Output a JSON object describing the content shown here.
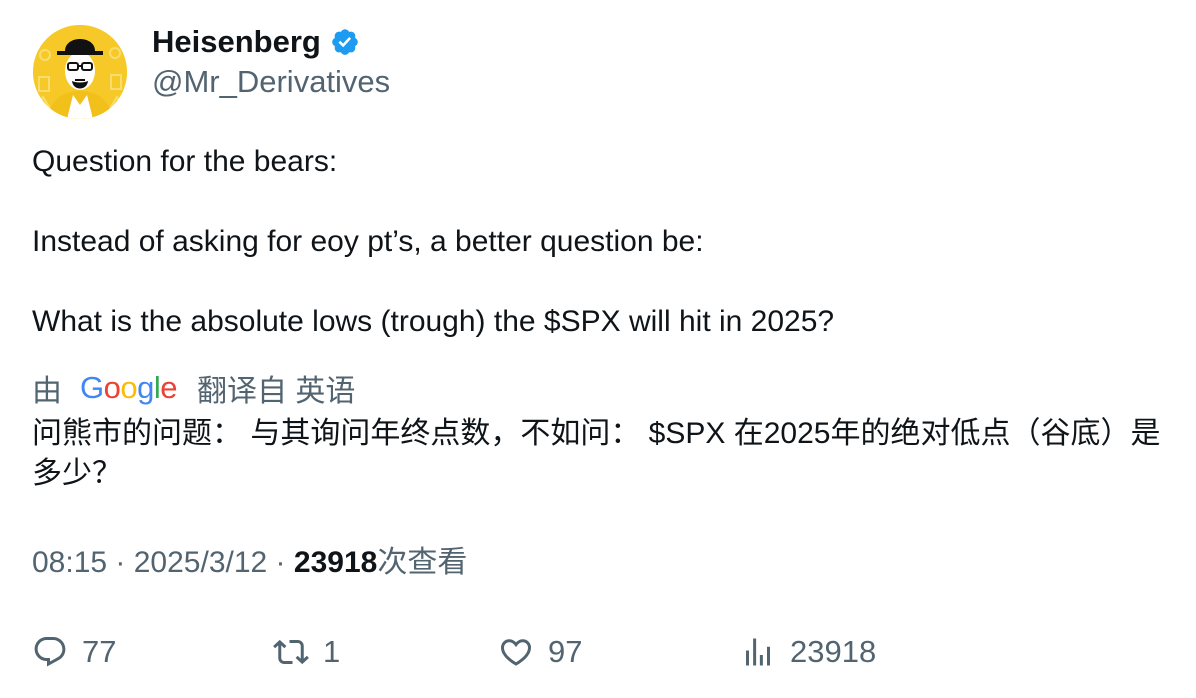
{
  "author": {
    "display_name": "Heisenberg",
    "handle": "@Mr_Derivatives",
    "verified": true,
    "verified_color": "#1d9bf0"
  },
  "tweet": {
    "lines": [
      "Question for the bears:",
      "Instead of asking for eoy pt’s, a better question be:",
      "What is the absolute lows (trough) the $SPX will hit in 2025?"
    ]
  },
  "translation": {
    "prefix": "由",
    "provider": "Google",
    "suffix": "翻译自 英语",
    "text": "问熊市的问题： 与其询问年终点数，不如问： $SPX 在2025年的绝对低点（谷底）是多少？"
  },
  "meta": {
    "time": "08:15",
    "separator": " · ",
    "date": "2025/3/12",
    "views_count": "23918",
    "views_label": "次查看"
  },
  "actions": {
    "replies": "77",
    "retweets": "1",
    "likes": "97",
    "views": "23918"
  },
  "colors": {
    "text": "#0f1419",
    "secondary": "#536471",
    "avatar_bg": "#f6c928"
  },
  "icons": [
    "reply-icon",
    "retweet-icon",
    "like-icon",
    "views-icon",
    "verified-badge-icon"
  ]
}
